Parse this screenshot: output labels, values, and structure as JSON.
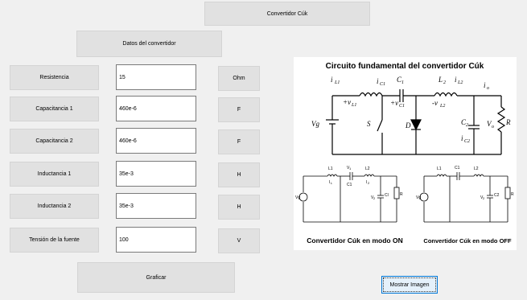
{
  "header": {
    "title_button": "Convertidor Cúk",
    "section_button": "Datos del convertidor"
  },
  "params": [
    {
      "label": "Resistencia",
      "value": "15",
      "unit": "Ohm"
    },
    {
      "label": "Capacitancia 1",
      "value": "460e-6",
      "unit": "F"
    },
    {
      "label": "Capacitancia 2",
      "value": "460e-6",
      "unit": "F"
    },
    {
      "label": "Inductancia 1",
      "value": "35e-3",
      "unit": "H"
    },
    {
      "label": "Inductancia 2",
      "value": "35e-3",
      "unit": "H"
    },
    {
      "label": "Tensión de la fuente",
      "value": "100",
      "unit": "V"
    }
  ],
  "actions": {
    "plot": "Graficar",
    "show_image": "Mostrar Imagen"
  },
  "figure": {
    "title": "Circuito fundamental del convertidor Cúk",
    "caption_on": "Convertidor Cúk en modo ON",
    "caption_off": "Convertidor Cúk en modo OFF",
    "labels": {
      "iL1": "i",
      "iL1_sub": "L1",
      "vL1": "+v",
      "vL1_sub": "L1",
      "c1": "C",
      "c1_sub": "1",
      "iC1": "i",
      "iC1_sub": "C1",
      "vC1": "+v",
      "vC1_sub": "C1",
      "l2": "L",
      "l2_sub": "2",
      "iL2": "i",
      "iL2_sub": "L2",
      "vL2": "-v",
      "vL2_sub": "L2",
      "io": "i",
      "io_sub": "o",
      "vg": "Vg",
      "s": "S",
      "d": "D",
      "c2": "C",
      "c2_sub": "2",
      "iC2": "i",
      "iC2_sub": "C2",
      "vo": "V",
      "vo_sub": "o",
      "r": "R",
      "small_l1": "L1",
      "small_l2": "L2",
      "small_v1": "V",
      "small_v1_sub": "1",
      "small_c1": "C1",
      "small_vg": "Vg",
      "small_v2": "V",
      "small_v2_sub": "2",
      "small_c2": "C2",
      "small_r": "R",
      "small_il": "I",
      "small_il_sub": "L",
      "small_i2": "I",
      "small_i2_sub": "2",
      "small_cl": "Cl"
    }
  },
  "colors": {
    "window_bg": "#f0f0f0",
    "button_bg": "#e1e1e1",
    "focus_border": "#0078d7"
  }
}
